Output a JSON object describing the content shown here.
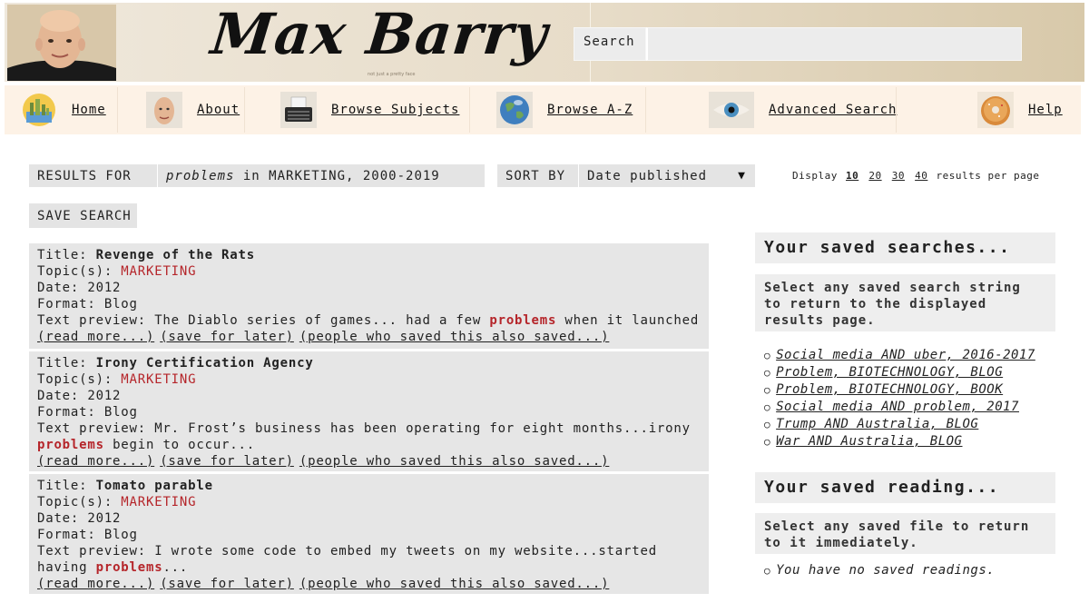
{
  "header": {
    "logo_text": "Max Barry",
    "tagline": "not just a pretty face",
    "search_label": "Search",
    "search_value": ""
  },
  "nav": [
    {
      "label": "Home",
      "icon": "city-icon"
    },
    {
      "label": "About",
      "icon": "face-icon"
    },
    {
      "label": "Browse Subjects",
      "icon": "typewriter-icon"
    },
    {
      "label": "Browse A-Z",
      "icon": "globe-icon"
    },
    {
      "label": "Advanced Search",
      "icon": "eye-icon"
    },
    {
      "label": "Help",
      "icon": "donut-icon"
    }
  ],
  "results_bar": {
    "results_label": "RESULTS FOR",
    "query_term": "problems",
    "query_rest": " in MARKETING, 2000-2019",
    "sort_label": "SORT BY",
    "sort_value": "Date published",
    "sort_arrow": "▼",
    "display_prefix": "Display",
    "display_options": [
      "10",
      "20",
      "30",
      "40"
    ],
    "display_selected": "10",
    "display_suffix": "results per page"
  },
  "save_search_label": "SAVE SEARCH",
  "labels": {
    "title": "Title: ",
    "topics": "Topic(s): ",
    "date": "Date: ",
    "format": "Format: ",
    "preview": "Text preview: ",
    "read_more": "(read more...)",
    "save_later": "(save for later)",
    "people_saved": "(people who saved this also saved...)"
  },
  "results": [
    {
      "title": "Revenge of the Rats",
      "topic": "MARKETING",
      "date": "2012",
      "format": "Blog",
      "preview_before": "The Diablo series of games... had a few ",
      "preview_hl": "problems",
      "preview_after": " when it launched"
    },
    {
      "title": "Irony Certification Agency",
      "topic": "MARKETING",
      "date": "2012",
      "format": "Blog",
      "preview_before": "Mr. Frost’s business has been operating for eight months...irony",
      "preview_hl": "problems",
      "preview_after": " begin to occur..."
    },
    {
      "title": "Tomato parable",
      "topic": "MARKETING",
      "date": "2012",
      "format": "Blog",
      "preview_before": "I wrote some code to embed my tweets on my website...started",
      "preview_hl2_prefix": "having ",
      "preview_hl": "problems",
      "preview_after": "..."
    }
  ],
  "sidebar": {
    "saved_searches_title": "Your saved searches...",
    "saved_searches_desc": "Select any saved search string to return to the displayed results page.",
    "saved_searches": [
      "Social media AND uber, 2016-2017",
      "Problem, BIOTECHNOLOGY, BLOG",
      "Problem, BIOTECHNOLOGY, BOOK",
      "Social media AND problem, 2017",
      "Trump AND Australia, BLOG",
      "War AND Australia, BLOG"
    ],
    "saved_reading_title": "Your saved reading...",
    "saved_reading_desc": "Select any saved file to return to it immediately.",
    "no_readings": "You have no saved readings.",
    "bullet": "○"
  },
  "colors": {
    "accent_red": "#b5252a",
    "panel_gray": "#e6e6e6",
    "nav_bg": "#fdf2e6"
  }
}
